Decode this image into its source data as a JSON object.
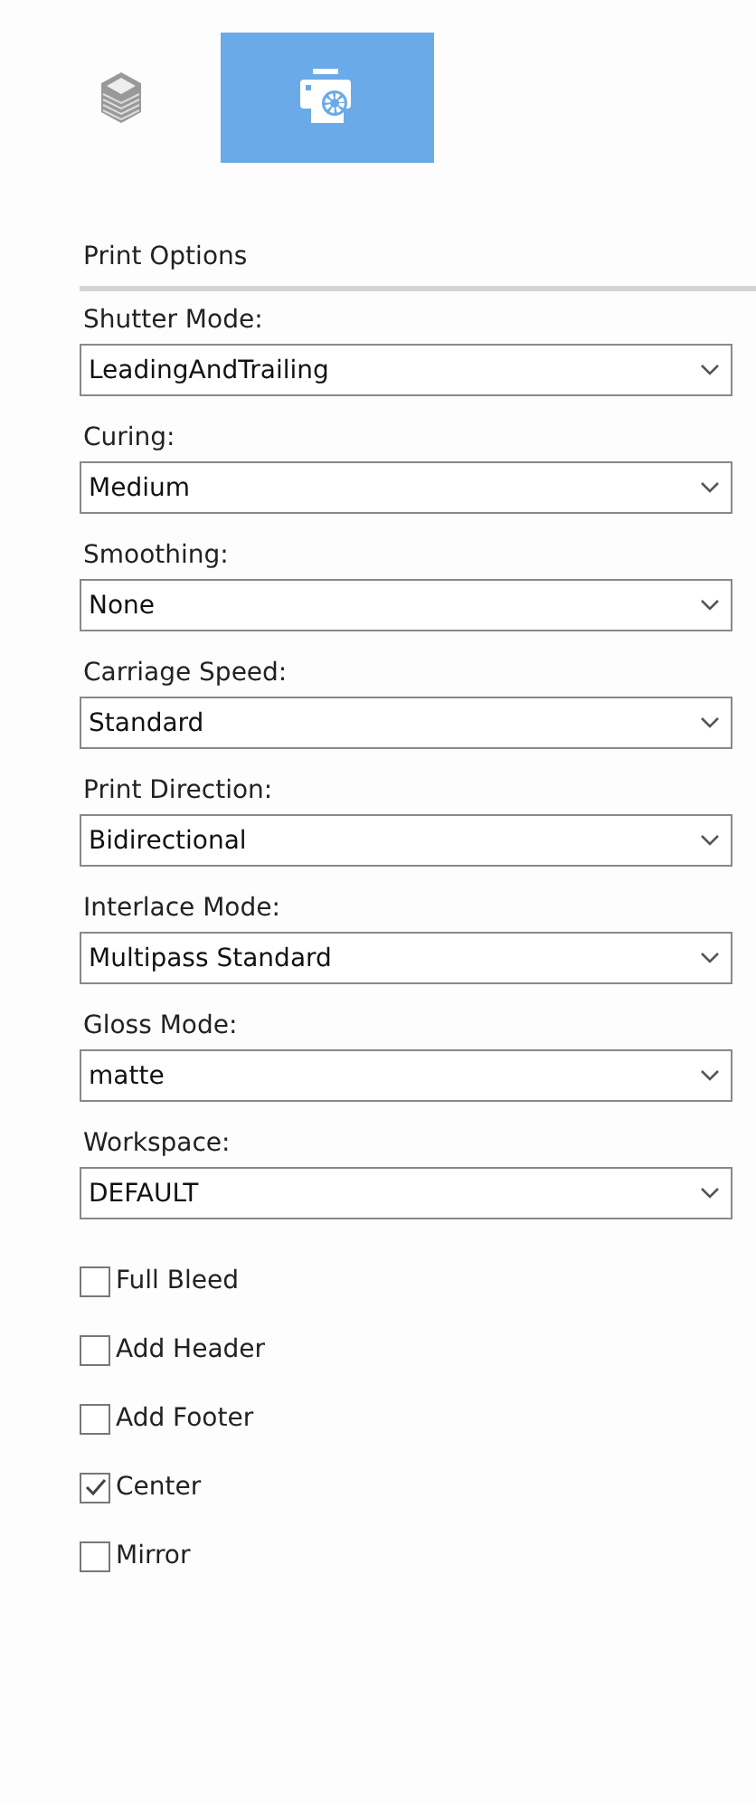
{
  "tabs": [
    {
      "kind": "layers",
      "selected": false
    },
    {
      "kind": "print-settings",
      "selected": true
    }
  ],
  "section_title": "Print Options",
  "fields": [
    {
      "label": "Shutter Mode:",
      "value": "LeadingAndTrailing"
    },
    {
      "label": "Curing:",
      "value": "Medium"
    },
    {
      "label": "Smoothing:",
      "value": "None"
    },
    {
      "label": "Carriage Speed:",
      "value": "Standard"
    },
    {
      "label": "Print Direction:",
      "value": "Bidirectional"
    },
    {
      "label": "Interlace Mode:",
      "value": "Multipass Standard"
    },
    {
      "label": "Gloss Mode:",
      "value": "matte"
    },
    {
      "label": "Workspace:",
      "value": "DEFAULT"
    }
  ],
  "checkboxes": [
    {
      "label": "Full Bleed",
      "checked": false
    },
    {
      "label": "Add Header",
      "checked": false
    },
    {
      "label": "Add Footer",
      "checked": false
    },
    {
      "label": "Center",
      "checked": true
    },
    {
      "label": "Mirror",
      "checked": false
    }
  ]
}
